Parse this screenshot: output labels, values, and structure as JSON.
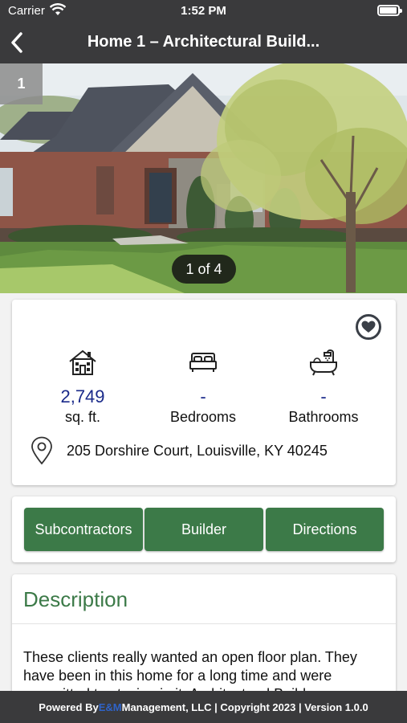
{
  "status_bar": {
    "carrier": "Carrier",
    "time": "1:52 PM",
    "battery_level": 0.95
  },
  "nav": {
    "title": "Home 1 – Architectural Build..."
  },
  "gallery": {
    "index_label": "1",
    "counter": "1 of 4"
  },
  "details": {
    "area_value": "2,749",
    "area_label": "sq. ft.",
    "bedrooms_value": "-",
    "bedrooms_label": "Bedrooms",
    "bathrooms_value": "-",
    "bathrooms_label": "Bathrooms",
    "address": "205 Dorshire Court, Louisville, KY 40245"
  },
  "actions": {
    "subcontractors": "Subcontractors",
    "builder": "Builder",
    "directions": "Directions"
  },
  "description": {
    "heading": "Description",
    "text": "These clients really wanted an open floor plan. They have been in this home for a long time and were committed to staying in it. Architectural Builders"
  },
  "footer": {
    "prefix": "Powered By ",
    "brand": "E&M",
    "suffix": " Management, LLC | Copyright 2023 | Version 1.0.0"
  },
  "colors": {
    "accent_green": "#3c7a48",
    "stat_value_blue": "#1a2a8a",
    "bar_dark": "#3a3a3c"
  }
}
